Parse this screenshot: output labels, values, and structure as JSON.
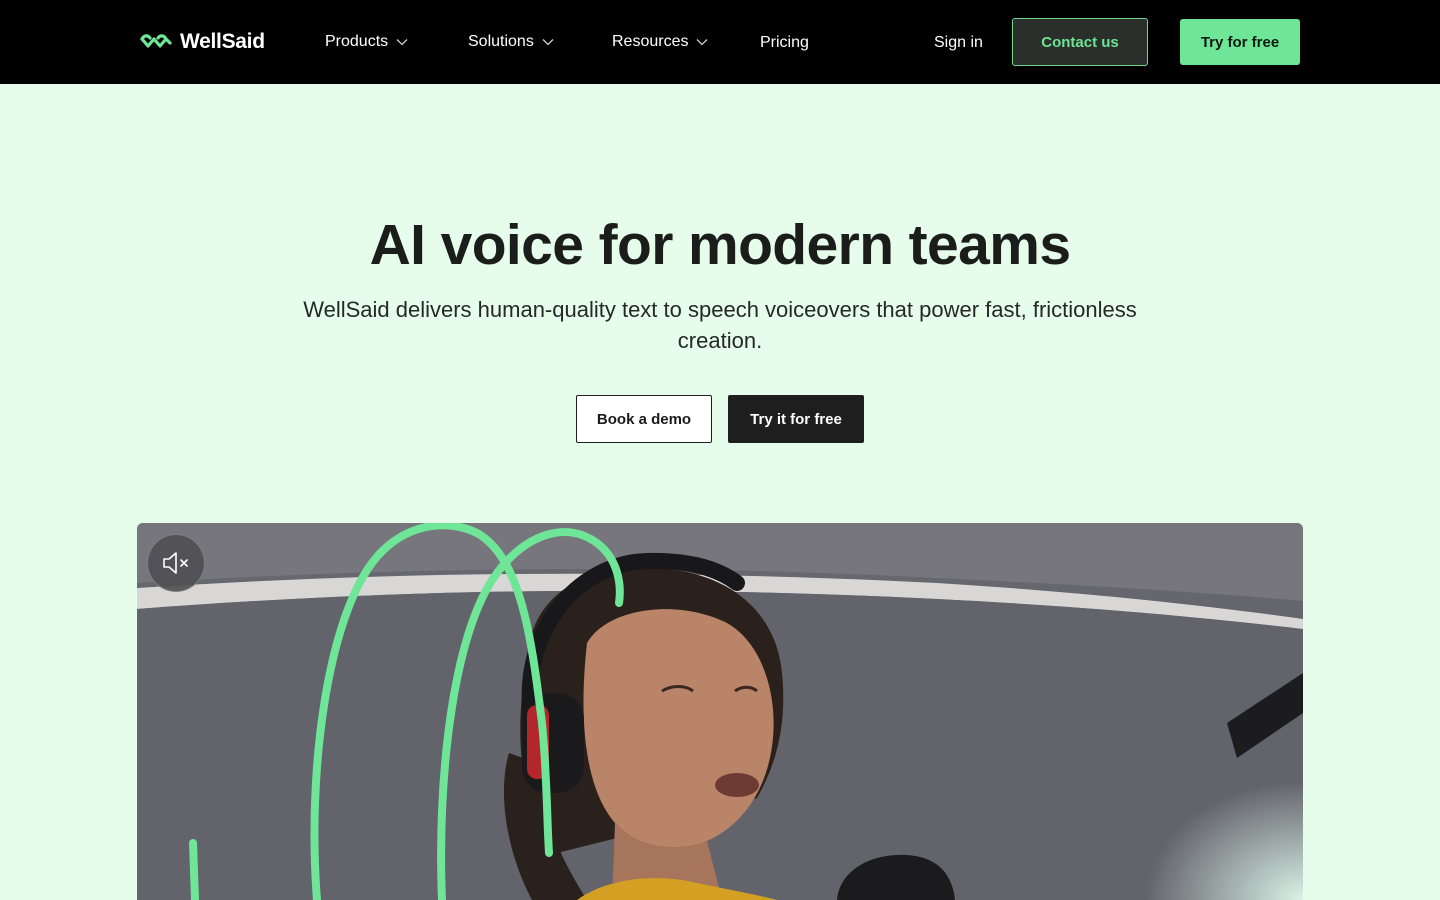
{
  "brand": {
    "name": "WellSaid"
  },
  "nav": {
    "items": [
      {
        "label": "Products",
        "has_dropdown": true
      },
      {
        "label": "Solutions",
        "has_dropdown": true
      },
      {
        "label": "Resources",
        "has_dropdown": true
      },
      {
        "label": "Pricing",
        "has_dropdown": false
      }
    ],
    "sign_in": "Sign in",
    "contact": "Contact us",
    "try_free": "Try for free"
  },
  "hero": {
    "title": "AI voice for modern teams",
    "subtitle": "WellSaid delivers human-quality text to speech voiceovers that power fast, frictionless creation.",
    "demo_button": "Book a demo",
    "try_button": "Try it for free"
  },
  "video": {
    "muted": true,
    "mute_icon": "speaker-muted-icon"
  },
  "colors": {
    "nav_bg": "#000000",
    "page_bg": "#e6fdec",
    "accent_green": "#6ee597",
    "dark_button": "#1e1e1e"
  }
}
